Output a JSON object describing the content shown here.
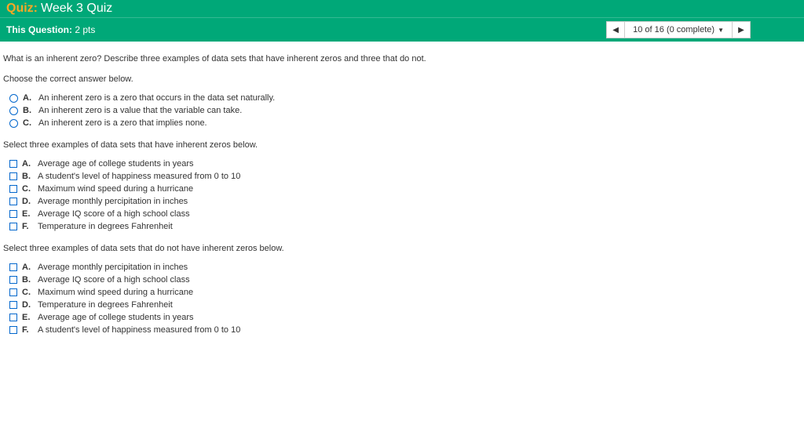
{
  "header": {
    "quiz_label": "Quiz:",
    "quiz_title": "Week 3 Quiz"
  },
  "subheader": {
    "question_label": "This Question:",
    "points": "2 pts",
    "nav_status": "10 of 16 (0 complete)"
  },
  "question": {
    "text": "What is an inherent zero? Describe three examples of data sets that have inherent zeros and three that do not.",
    "instruction1": "Choose the correct answer below.",
    "group1": [
      {
        "letter": "A.",
        "text": "An inherent zero is a zero that occurs in the data set naturally."
      },
      {
        "letter": "B.",
        "text": "An inherent zero is a value that the variable can take."
      },
      {
        "letter": "C.",
        "text": "An inherent zero is a zero that implies none."
      }
    ],
    "instruction2": "Select three examples of data sets that have inherent zeros below.",
    "group2": [
      {
        "letter": "A.",
        "text": "Average age of college students in years"
      },
      {
        "letter": "B.",
        "text": "A student's level of happiness measured from 0 to 10"
      },
      {
        "letter": "C.",
        "text": "Maximum wind speed during a hurricane"
      },
      {
        "letter": "D.",
        "text": "Average monthly percipitation in inches"
      },
      {
        "letter": "E.",
        "text": "Average IQ score of a high school class"
      },
      {
        "letter": "F.",
        "text": "Temperature in degrees Fahrenheit"
      }
    ],
    "instruction3": "Select three examples of data sets that do not have inherent zeros below.",
    "group3": [
      {
        "letter": "A.",
        "text": "Average monthly percipitation in inches"
      },
      {
        "letter": "B.",
        "text": "Average IQ score of a high school class"
      },
      {
        "letter": "C.",
        "text": "Maximum wind speed during a hurricane"
      },
      {
        "letter": "D.",
        "text": "Temperature in degrees Fahrenheit"
      },
      {
        "letter": "E.",
        "text": "Average age of college students in years"
      },
      {
        "letter": "F.",
        "text": "A student's level of happiness measured from 0 to 10"
      }
    ]
  }
}
